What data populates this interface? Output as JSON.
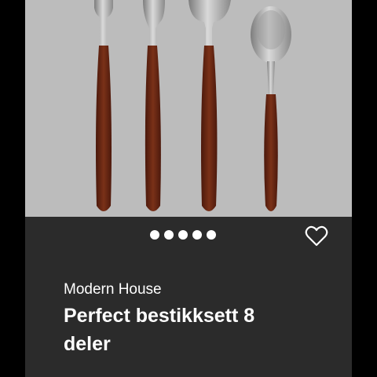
{
  "colors": {
    "page_background": "#000000",
    "image_background": "#bcbcbc",
    "info_background": "#2b2b2b",
    "text": "#ffffff",
    "wood": "#6e2a16",
    "steel": "#a8a8a8"
  },
  "carousel": {
    "dot_count": 5
  },
  "actions": {
    "favorite_icon": "heart-outline-icon"
  },
  "product": {
    "brand": "Modern House",
    "title": "Perfect bestikksett 8 deler",
    "image_subject": "cutlery set: fork, knife, spoon, teaspoon with wooden handles"
  }
}
